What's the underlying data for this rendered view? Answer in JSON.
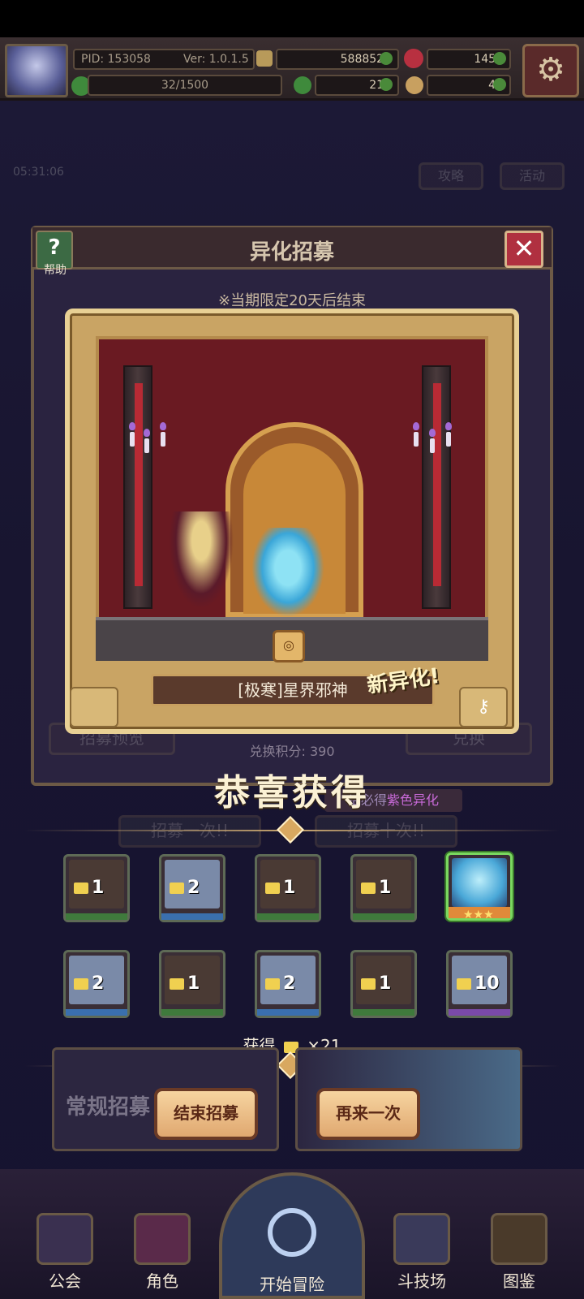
{
  "topbar": {
    "pid": "PID: 153058",
    "version": "Ver: 1.0.1.5",
    "gold": "5888520",
    "gems": "1451",
    "stamina": "32/1500",
    "clover": "217",
    "food": "42"
  },
  "bg": {
    "timer": "05:31:06",
    "strategy": "攻略",
    "activity": "活动"
  },
  "panel": {
    "title": "异化招募",
    "help_label": "帮助",
    "close_icon": "✕",
    "limited_notice": "※当期限定20天后结束",
    "preview_button": "招募预览",
    "exchange_button": "兑换",
    "points": "兑换积分: 390",
    "hint_prefix": "抽必得",
    "hint_highlight": "紫色异化",
    "recruit_once": "招募一次!!",
    "recruit_ten": "招募十次!!"
  },
  "card": {
    "name": "[极寒]星界邪神",
    "new_tag": "新异化!"
  },
  "congrats": "恭喜获得",
  "rewards": [
    {
      "qty": "1",
      "rarity_color": "#3f7a3c"
    },
    {
      "qty": "2",
      "rarity_color": "#3a6fae"
    },
    {
      "qty": "1",
      "rarity_color": "#3f7a3c"
    },
    {
      "qty": "1",
      "rarity_color": "#3f7a3c"
    },
    {
      "qty": "",
      "rarity_color": "#e08a3a",
      "stars": "★★★"
    },
    {
      "qty": "2",
      "rarity_color": "#3a6fae"
    },
    {
      "qty": "1",
      "rarity_color": "#3f7a3c"
    },
    {
      "qty": "2",
      "rarity_color": "#3a6fae"
    },
    {
      "qty": "1",
      "rarity_color": "#3f7a3c"
    },
    {
      "qty": "10",
      "rarity_color": "#7a4aa8"
    }
  ],
  "gain": {
    "label": "获得",
    "amount": "×21"
  },
  "actions": {
    "end": "结束招募",
    "again": "再来一次",
    "normal_recruit": "常规招募"
  },
  "nav": {
    "guild": "公会",
    "role": "角色",
    "adventure": "开始冒险",
    "arena": "斗技场",
    "codex": "图鉴"
  },
  "colors": {
    "gold": "#d8b878",
    "accent": "#c8a060",
    "bg": "#141226"
  }
}
